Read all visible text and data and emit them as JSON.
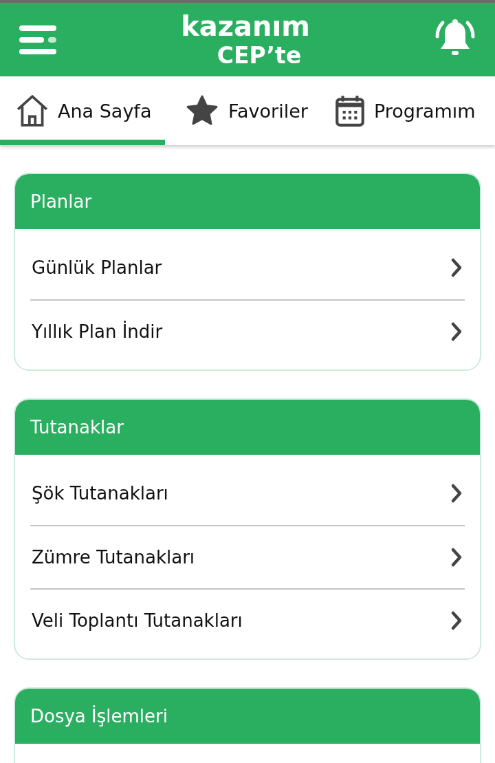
{
  "header": {
    "title_line_1": "kazanım",
    "title_line_2": "CEP’te"
  },
  "tabs": [
    {
      "label": "Ana Sayfa",
      "kind": "home",
      "selected": true
    },
    {
      "label": "Favoriler",
      "kind": "star",
      "selected": false
    },
    {
      "label": "Programım",
      "kind": "calendar",
      "selected": false
    }
  ],
  "sections": [
    {
      "title": "Planlar",
      "items": [
        "Günlük Planlar",
        "Yıllık Plan İndir"
      ]
    },
    {
      "title": "Tutanaklar",
      "items": [
        "Şök Tutanakları",
        "Zümre Tutanakları",
        "Veli Toplantı Tutanakları"
      ]
    },
    {
      "title": "Dosya İşlemleri"
    }
  ]
}
